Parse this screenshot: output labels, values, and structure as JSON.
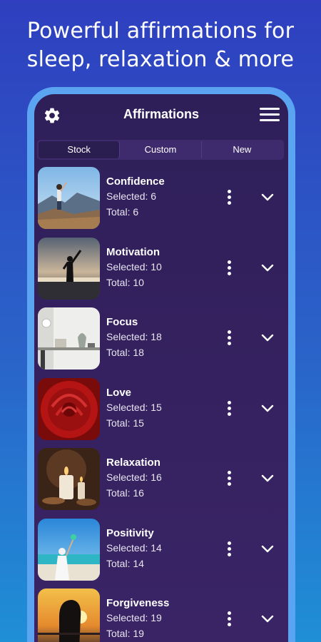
{
  "promo": {
    "line1": "Powerful affirmations for",
    "line2": "sleep, relaxation & more"
  },
  "app": {
    "title": "Affirmations",
    "tabs": [
      {
        "label": "Stock",
        "active": true
      },
      {
        "label": "Custom",
        "active": false
      },
      {
        "label": "New",
        "active": false
      }
    ],
    "categories": [
      {
        "name": "Confidence",
        "selected": "Selected: 6",
        "total": "Total: 6",
        "image": "mountain-person"
      },
      {
        "name": "Motivation",
        "selected": "Selected: 10",
        "total": "Total: 10",
        "image": "sunset-silhouette"
      },
      {
        "name": "Focus",
        "selected": "Selected: 18",
        "total": "Total: 18",
        "image": "desk"
      },
      {
        "name": "Love",
        "selected": "Selected: 15",
        "total": "Total: 15",
        "image": "red-rose"
      },
      {
        "name": "Relaxation",
        "selected": "Selected: 16",
        "total": "Total: 16",
        "image": "candles"
      },
      {
        "name": "Positivity",
        "selected": "Selected: 14",
        "total": "Total: 14",
        "image": "beach"
      },
      {
        "name": "Forgiveness",
        "selected": "Selected: 19",
        "total": "Total: 19",
        "image": "sunset-portrait"
      }
    ]
  },
  "icons": {
    "settings": "gear-icon",
    "menu": "hamburger-menu-icon",
    "more": "more-vertical-icon",
    "expand": "chevron-down-icon"
  },
  "colors": {
    "background_top": "#2f3fbf",
    "background_bottom": "#1f8fd6",
    "phone_frame": "#5aa4f2",
    "screen": "#32215d"
  }
}
